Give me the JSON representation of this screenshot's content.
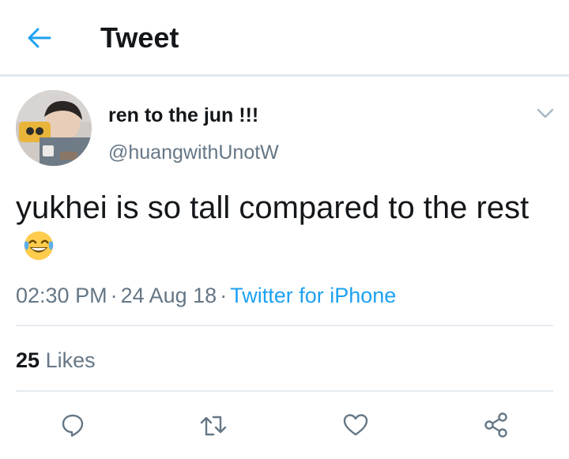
{
  "header": {
    "back_icon": "arrow-left-icon",
    "title": "Tweet"
  },
  "tweet": {
    "display_name": "ren to the jun !!!",
    "handle": "@huangwithUnotW",
    "text": "yukhei is so tall compared to the rest",
    "emoji": "face-with-tears-of-joy",
    "time": "02:30 PM",
    "date": "24 Aug 18",
    "source": "Twitter for iPhone",
    "likes_count": "25",
    "likes_label": "Likes"
  },
  "actions": [
    {
      "name": "reply",
      "icon": "reply-icon"
    },
    {
      "name": "retweet",
      "icon": "retweet-icon"
    },
    {
      "name": "like",
      "icon": "heart-icon"
    },
    {
      "name": "share",
      "icon": "share-icon"
    }
  ],
  "colors": {
    "accent": "#1da1f2",
    "text_primary": "#14171a",
    "text_secondary": "#657786",
    "divider": "#e6ecf0"
  }
}
